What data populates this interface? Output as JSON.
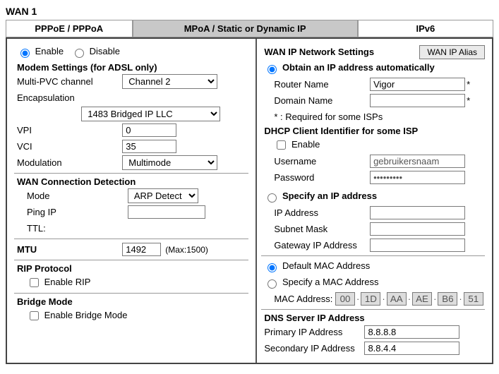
{
  "title": "WAN 1",
  "tabs": {
    "pppoe": "PPPoE / PPPoA",
    "mpoa": "MPoA / Static or Dynamic IP",
    "ipv6": "IPv6"
  },
  "left": {
    "enable": "Enable",
    "disable": "Disable",
    "modem_head": "Modem Settings (for ADSL only)",
    "multi_pvc": "Multi-PVC channel",
    "multi_pvc_val": "Channel 2",
    "encap": "Encapsulation",
    "encap_val": "1483 Bridged IP LLC",
    "vpi": "VPI",
    "vpi_val": "0",
    "vci": "VCI",
    "vci_val": "35",
    "modulation": "Modulation",
    "modulation_val": "Multimode",
    "wcd_head": "WAN Connection Detection",
    "mode": "Mode",
    "mode_val": "ARP Detect",
    "ping_ip": "Ping IP",
    "ttl": "TTL:",
    "mtu": "MTU",
    "mtu_val": "1492",
    "mtu_note": "(Max:1500)",
    "rip_head": "RIP Protocol",
    "enable_rip": "Enable RIP",
    "bridge_head": "Bridge Mode",
    "enable_bridge": "Enable Bridge Mode"
  },
  "right": {
    "net_head": "WAN IP Network Settings",
    "alias_btn": "WAN IP Alias",
    "auto_opt": "Obtain an IP address automatically",
    "router_name": "Router Name",
    "router_name_val": "Vigor",
    "domain_name": "Domain Name",
    "domain_name_val": "",
    "req_note": "* : Required for some ISPs",
    "dhcp_head": "DHCP Client Identifier for some ISP",
    "dhcp_enable": "Enable",
    "username": "Username",
    "username_ph": "gebruikersnaam",
    "password": "Password",
    "password_val": "•••••••••",
    "spec_opt": "Specify an IP address",
    "ip_addr": "IP Address",
    "subnet": "Subnet Mask",
    "gateway": "Gateway IP Address",
    "mac_def": "Default MAC Address",
    "mac_spec": "Specify a MAC Address",
    "mac_label": "MAC Address:",
    "mac": [
      "00",
      "1D",
      "AA",
      "AE",
      "B6",
      "51"
    ],
    "dns_head": "DNS Server IP Address",
    "pri_ip": "Primary IP Address",
    "pri_ip_val": "8.8.8.8",
    "sec_ip": "Secondary IP Address",
    "sec_ip_val": "8.8.4.4"
  }
}
